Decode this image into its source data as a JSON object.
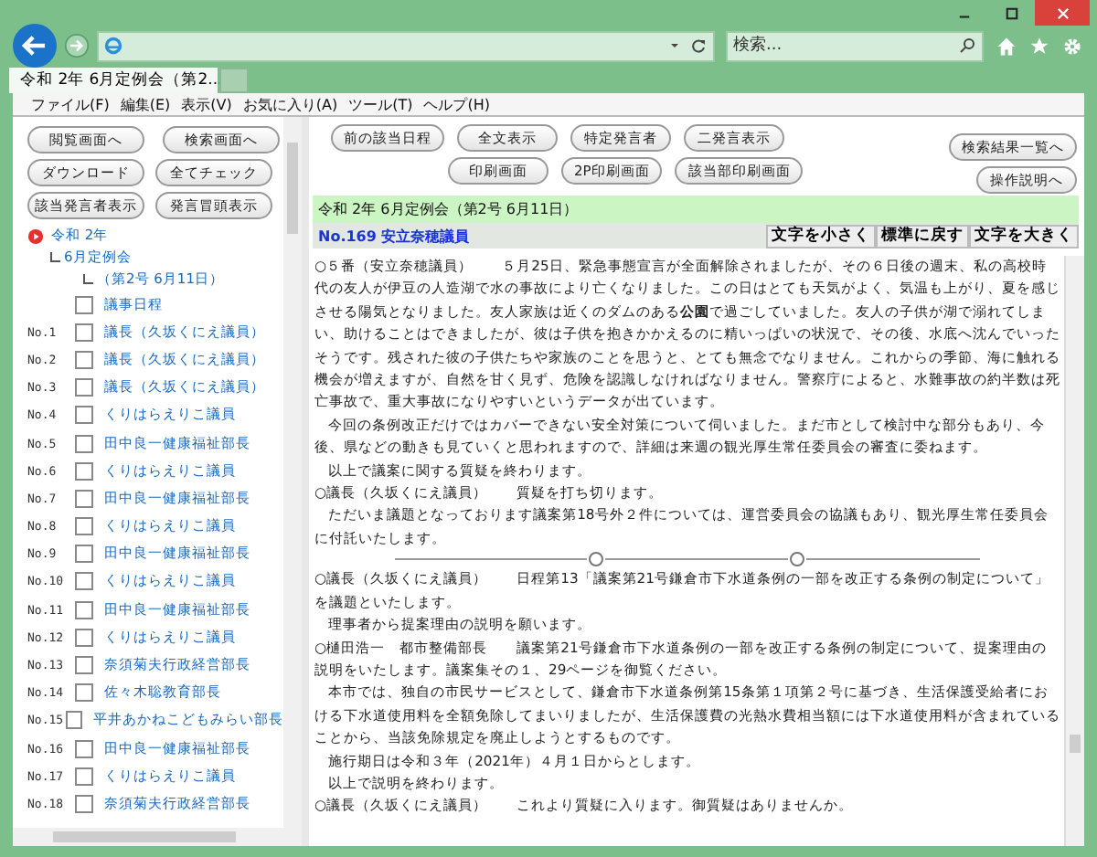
{
  "browser": {
    "tab_title": "令和 2年 6月定例会（第2...",
    "search_placeholder": "検索...",
    "menu": [
      "ファイル(F)",
      "編集(E)",
      "表示(V)",
      "お気に入り(A)",
      "ツール(T)",
      "ヘルプ(H)"
    ]
  },
  "left": {
    "buttons": [
      [
        "閲覧画面へ",
        "検索画面へ"
      ],
      [
        "ダウンロード",
        "全てチェック"
      ],
      [
        "該当発言者表示",
        "発言冒頭表示"
      ]
    ],
    "tree": {
      "era": "令和 2年",
      "session": "6月定例会",
      "issue": "（第2号 6月11日）",
      "expanded": true
    },
    "items": [
      {
        "label": "議事日程",
        "checked": false
      },
      {
        "no": "No.1",
        "label": "議長（久坂くにえ議員）",
        "checked": false
      },
      {
        "no": "No.2",
        "label": "議長（久坂くにえ議員）",
        "checked": false
      },
      {
        "no": "No.3",
        "label": "議長（久坂くにえ議員）",
        "checked": false
      },
      {
        "no": "No.4",
        "label": "くりはらえりこ議員",
        "checked": false
      },
      {
        "no": "No.5",
        "label": "田中良一健康福祉部長",
        "checked": false
      },
      {
        "no": "No.6",
        "label": "くりはらえりこ議員",
        "checked": false
      },
      {
        "no": "No.7",
        "label": "田中良一健康福祉部長",
        "checked": false
      },
      {
        "no": "No.8",
        "label": "くりはらえりこ議員",
        "checked": false
      },
      {
        "no": "No.9",
        "label": "田中良一健康福祉部長",
        "checked": false
      },
      {
        "no": "No.10",
        "label": "くりはらえりこ議員",
        "checked": false
      },
      {
        "no": "No.11",
        "label": "田中良一健康福祉部長",
        "checked": false
      },
      {
        "no": "No.12",
        "label": "くりはらえりこ議員",
        "checked": false
      },
      {
        "no": "No.13",
        "label": "奈須菊夫行政経営部長",
        "checked": false
      },
      {
        "no": "No.14",
        "label": "佐々木聡教育部長",
        "checked": false
      },
      {
        "no": "No.15",
        "label": "平井あかねこどもみらい部長",
        "checked": false
      },
      {
        "no": "No.16",
        "label": "田中良一健康福祉部長",
        "checked": false
      },
      {
        "no": "No.17",
        "label": "くりはらえりこ議員",
        "checked": false
      },
      {
        "no": "No.18",
        "label": "奈須菊夫行政経営部長",
        "checked": false
      }
    ]
  },
  "main": {
    "toolbar_left": [
      [
        "前の該当日程",
        "全文表示",
        "特定発言者",
        "二発言表示"
      ],
      [
        "印刷画面",
        "2P印刷画面",
        "該当部印刷画面"
      ]
    ],
    "toolbar_right": [
      "検索結果一覧へ",
      "操作説明へ"
    ],
    "header_title": "令和 2年 6月定例会（第2号 6月11日）",
    "speaker": "No.169 安立奈穂議員",
    "font_buttons": [
      "文字を小さく",
      "標準に戻す",
      "文字を大きく"
    ],
    "paragraphs": [
      {
        "kind": "speech",
        "text": "○５番（安立奈穂議員）　　５月25日、緊急事態宣言が全面解除されましたが、その６日後の週末、私の高校時代の友人が伊豆の人造湖で水の事故により亡くなりました。この日はとても天気がよく、気温も上がり、夏を感じさせる陽気となりました。友人家族は近くのダムのある**公園**で過ごしていました。友人の子供が湖で溺れてしまい、助けることはできましたが、彼は子供を抱きかかえるのに精いっぱいの状況で、その後、水底へ沈んでいったそうです。残された彼の子供たちや家族のことを思うと、とても無念でなりません。これからの季節、海に触れる機会が増えますが、自然を甘く見ず、危険を認識しなければなりません。警察庁によると、水難事故の約半数は死亡事故で、重大事故になりやすいというデータが出ています。"
      },
      {
        "kind": "body",
        "text": "今回の条例改正だけではカバーできない安全対策について伺いました。まだ市として検討中な部分もあり、今後、県などの動きも見ていくと思われますので、詳細は来週の観光厚生常任委員会の審査に委ねます。"
      },
      {
        "kind": "body",
        "text": "以上で議案に関する質疑を終わります。"
      },
      {
        "kind": "speech",
        "text": "○議長（久坂くにえ議員）　　質疑を打ち切ります。"
      },
      {
        "kind": "body",
        "text": "ただいま議題となっております議案第18号外２件については、運営委員会の協議もあり、観光厚生常任委員会に付託いたします。"
      },
      {
        "kind": "separator"
      },
      {
        "kind": "speech",
        "text": "○議長（久坂くにえ議員）　　日程第13「議案第21号鎌倉市下水道条例の一部を改正する条例の制定について」を議題といたします。"
      },
      {
        "kind": "body",
        "text": "理事者から提案理由の説明を願います。"
      },
      {
        "kind": "speech",
        "text": "○樋田浩一　都市整備部長　　議案第21号鎌倉市下水道条例の一部を改正する条例の制定について、提案理由の説明をいたします。議案集その１、29ページを御覧ください。"
      },
      {
        "kind": "body",
        "text": "本市では、独自の市民サービスとして、鎌倉市下水道条例第15条第１項第２号に基づき、生活保護受給者における下水道使用料を全額免除してまいりましたが、生活保護費の光熱水費相当額には下水道使用料が含まれていることから、当該免除規定を廃止しようとするものです。"
      },
      {
        "kind": "body",
        "text": "施行期日は令和３年（2021年）４月１日からとします。"
      },
      {
        "kind": "body",
        "text": "以上で説明を終わります。"
      },
      {
        "kind": "speech",
        "text": "○議長（久坂くにえ議員）　　これより質疑に入ります。御質疑はありませんか。"
      }
    ]
  }
}
